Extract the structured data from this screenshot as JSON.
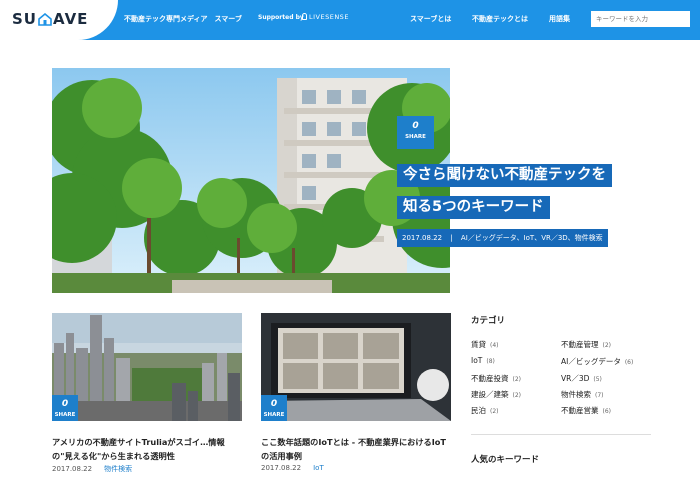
{
  "header": {
    "logo_left": "SU",
    "logo_right": "AVE",
    "tagline": "不動産テック専門メディア　スマーブ",
    "supported_by": "Supported by",
    "partner": "LIVESENSE",
    "nav": [
      "スマーブとは",
      "不動産テックとは",
      "用語集"
    ],
    "search_placeholder": "キーワードを入力",
    "colors": {
      "header_bg": "#1e93e6",
      "badge": "#1e7fcb",
      "title_bg": "#1769b8"
    }
  },
  "hero": {
    "share_count": "0",
    "share_label": "SHARE",
    "title_line1": "今さら聞けない不動産テックを",
    "title_line2": "知る5つのキーワード",
    "date": "2017.08.22",
    "tags": "AI／ビッグデータ、IoT、VR／3D、物件検索"
  },
  "cards": [
    {
      "share_count": "0",
      "share_label": "SHARE",
      "title": "アメリカの不動産サイトTruliaがスゴイ…情報の\"見える化\"から生まれる透明性",
      "date": "2017.08.22",
      "tag": "物件検索"
    },
    {
      "share_count": "0",
      "share_label": "SHARE",
      "title": "ここ数年話題のIoTとは - 不動産業界におけるIoTの活用事例",
      "date": "2017.08.22",
      "tag": "IoT"
    }
  ],
  "sidebar": {
    "category_heading": "カテゴリ",
    "categories": [
      {
        "label": "賃貸",
        "count": "(4)"
      },
      {
        "label": "不動産管理",
        "count": "(2)"
      },
      {
        "label": "IoT",
        "count": "(8)"
      },
      {
        "label": "AI／ビッグデータ",
        "count": "(6)"
      },
      {
        "label": "不動産投資",
        "count": "(2)"
      },
      {
        "label": "VR／3D",
        "count": "(5)"
      },
      {
        "label": "建設／建築",
        "count": "(2)"
      },
      {
        "label": "物件検索",
        "count": "(7)"
      },
      {
        "label": "民泊",
        "count": "(2)"
      },
      {
        "label": "不動産営業",
        "count": "(6)"
      }
    ],
    "keyword_heading": "人気のキーワード"
  }
}
